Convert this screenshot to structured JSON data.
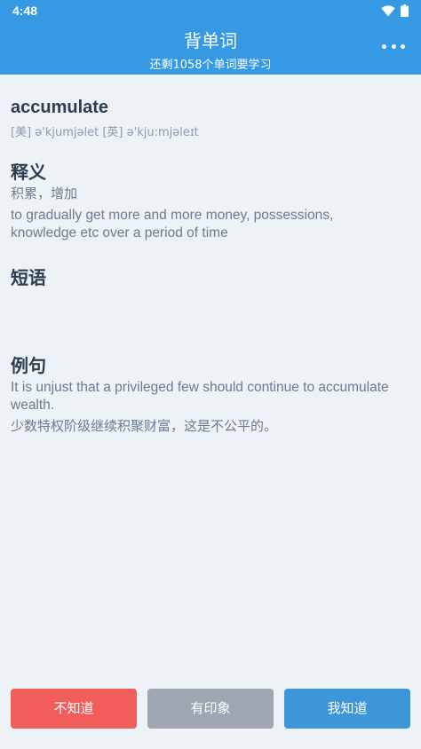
{
  "status": {
    "time": "4:48"
  },
  "header": {
    "title": "背单词",
    "subtitle": "还剩1058个单词要学习"
  },
  "word": {
    "text": "accumulate",
    "phonetic": "[美] ə'kjumjəlet  [英] ə'kju:mjəleɪt"
  },
  "definition": {
    "title": "释义",
    "cn": "积累，增加",
    "en": "to gradually get more and more money, possessions, knowledge etc over a period of time"
  },
  "phrases": {
    "title": "短语"
  },
  "example": {
    "title": "例句",
    "en": "It is unjust that a privileged few should continue to accumulate wealth.",
    "cn": "少数特权阶级继续积聚财富，这是不公平的。"
  },
  "buttons": {
    "dont_know": "不知道",
    "impression": "有印象",
    "know": "我知道"
  },
  "colors": {
    "header": "#3599e3",
    "dont_know": "#f05d5b",
    "impression": "#9ea7b1",
    "know": "#3c96d8"
  }
}
